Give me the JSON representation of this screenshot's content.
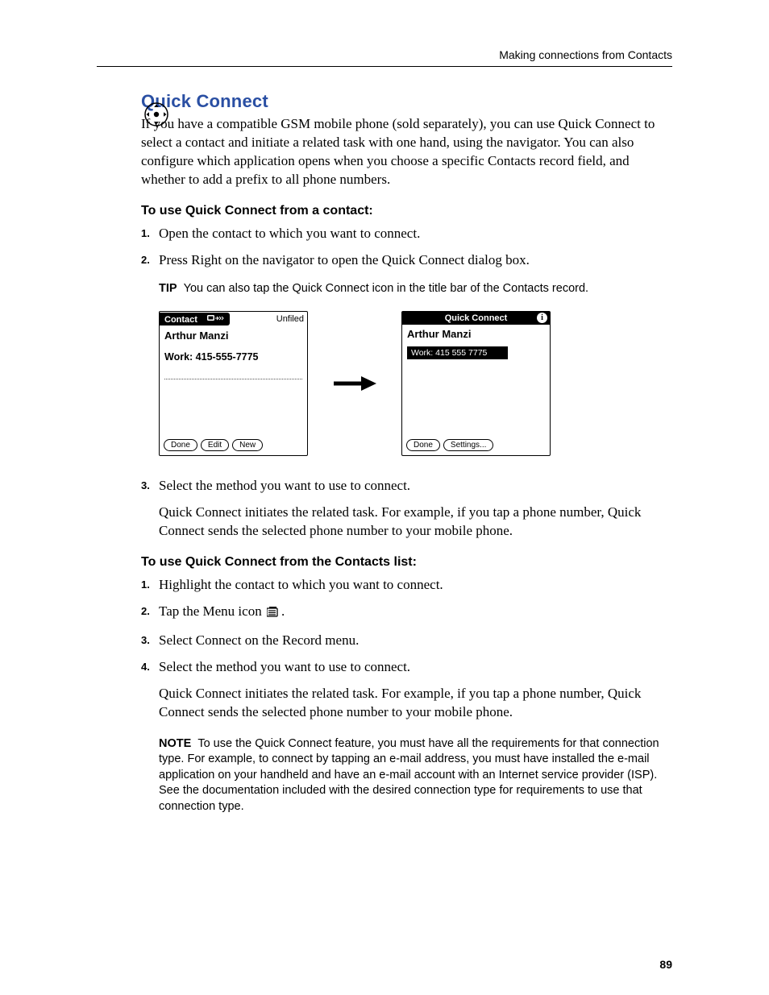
{
  "header": {
    "running_head": "Making connections from Contacts"
  },
  "section": {
    "title": "Quick Connect",
    "intro": "If you have a compatible GSM mobile phone (sold separately), you can use Quick Connect to select a contact and initiate a related task with one hand, using the navigator. You can also configure which application opens when you choose a specific Contacts record field, and whether to add a prefix to all phone numbers."
  },
  "proc1": {
    "heading": "To use Quick Connect from a contact:",
    "steps": [
      "Open the contact to which you want to connect.",
      "Press Right on the navigator to open the Quick Connect dialog box."
    ],
    "tip_label": "TIP",
    "tip_text": "You can also tap the Quick Connect icon in the title bar of the Contacts record.",
    "step3": "Select the method you want to use to connect.",
    "result": "Quick Connect initiates the related task. For example, if you tap a phone number, Quick Connect sends the selected phone number to your mobile phone."
  },
  "proc2": {
    "heading": "To use Quick Connect from the Contacts list:",
    "steps": [
      "Highlight the contact to which you want to connect.",
      "Tap the Menu icon ",
      "Select Connect on the Record menu.",
      "Select the method you want to use to connect."
    ],
    "step2_suffix": ".",
    "result": "Quick Connect initiates the related task. For example, if you tap a phone number, Quick Connect sends the selected phone number to your mobile phone.",
    "note_label": "NOTE",
    "note_text": "To use the Quick Connect feature, you must have all the requirements for that connection type. For example, to connect by tapping an e-mail address, you must have installed the e-mail application on your handheld and have an e-mail account with an Internet service provider (ISP). See the documentation included with the desired connection type for requirements to use that connection type."
  },
  "screenshots": {
    "contact": {
      "title": "Contact",
      "category": "Unfiled",
      "name": "Arthur Manzi",
      "field": "Work:   415-555-7775",
      "buttons": [
        "Done",
        "Edit",
        "New"
      ]
    },
    "qc": {
      "title": "Quick Connect",
      "name": "Arthur Manzi",
      "selected": "Work: 415 555 7775",
      "buttons": [
        "Done",
        "Settings..."
      ]
    }
  },
  "footer": {
    "page": "89"
  }
}
